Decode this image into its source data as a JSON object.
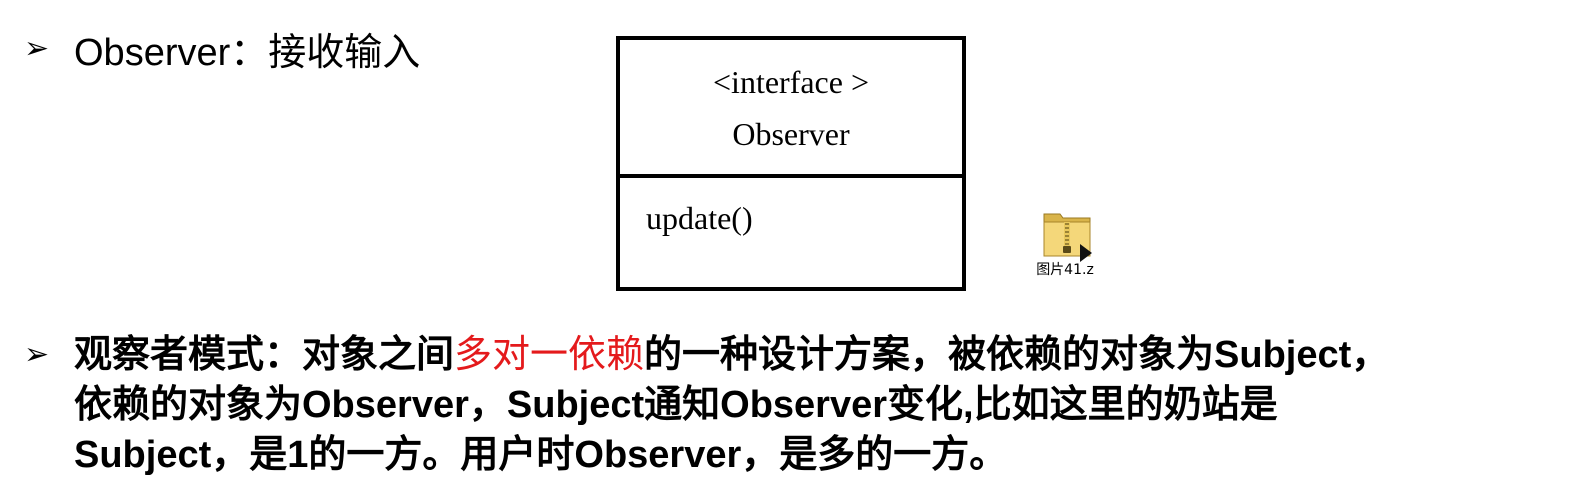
{
  "bullet_glyph": "➢",
  "bullet1": {
    "text": "Observer：接收输入"
  },
  "uml": {
    "stereotype": "<interface >",
    "class_name": "Observer",
    "method": "update()"
  },
  "file_attachment": {
    "icon": "zip-folder-icon",
    "label": "图片41.z"
  },
  "bullet2": {
    "part1": "观察者模式：对象之间",
    "highlight": "多对一依赖",
    "part2": "的一种设计方案，被依赖的对象为Subject，",
    "line2": "依赖的对象为Observer，Subject通知Observer变化,比如这里的奶站是",
    "line3": "Subject，是1的一方。用户时Observer，是多的一方。",
    "highlight_color": "#e41a1c"
  }
}
